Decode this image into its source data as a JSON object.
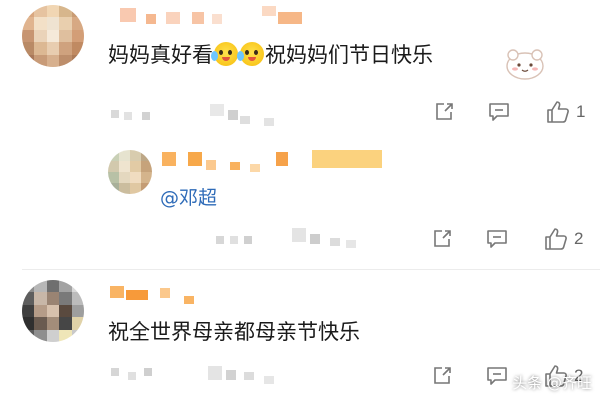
{
  "comments": [
    {
      "text_before": "妈妈真好看",
      "emoji_names": [
        "crying-face-emoji",
        "crying-face-emoji"
      ],
      "text_after": "祝妈妈们节日快乐",
      "like_count": "1"
    },
    {
      "mention": "@邓超",
      "like_count": "2"
    },
    {
      "text": "祝全世界母亲都母亲节快乐",
      "like_count": "2"
    }
  ],
  "watermark": "头条 @齐旺",
  "icons": {
    "share": "share-icon",
    "reply": "reply-icon",
    "like": "thumbs-up-icon"
  },
  "colors": {
    "mention_blue": "#2e6bb8",
    "username_orange": "#f7a84a",
    "icon_gray": "#777777"
  }
}
